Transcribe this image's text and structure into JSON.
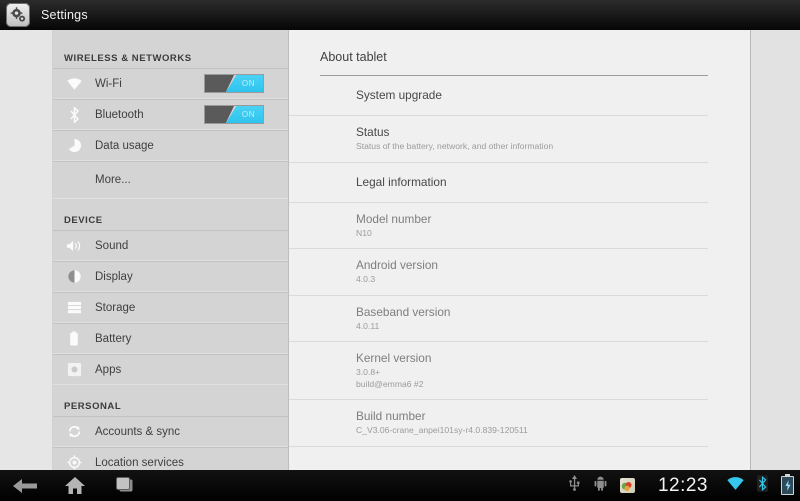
{
  "app": {
    "title": "Settings",
    "icon": "settings-gear-icon"
  },
  "sidebar": {
    "sections": [
      {
        "header": "WIRELESS & NETWORKS",
        "items": [
          {
            "label": "Wi-Fi",
            "icon": "wifi-icon",
            "toggle": "ON"
          },
          {
            "label": "Bluetooth",
            "icon": "bluetooth-icon",
            "toggle": "ON"
          },
          {
            "label": "Data usage",
            "icon": "data-usage-icon"
          },
          {
            "label": "More...",
            "icon": null
          }
        ]
      },
      {
        "header": "DEVICE",
        "items": [
          {
            "label": "Sound",
            "icon": "sound-icon"
          },
          {
            "label": "Display",
            "icon": "display-icon"
          },
          {
            "label": "Storage",
            "icon": "storage-icon"
          },
          {
            "label": "Battery",
            "icon": "battery-icon"
          },
          {
            "label": "Apps",
            "icon": "apps-icon"
          }
        ]
      },
      {
        "header": "PERSONAL",
        "items": [
          {
            "label": "Accounts & sync",
            "icon": "sync-icon"
          },
          {
            "label": "Location services",
            "icon": "location-icon"
          }
        ]
      }
    ]
  },
  "content": {
    "title": "About tablet",
    "items": [
      {
        "title": "System upgrade",
        "subtitle": null,
        "dim": false
      },
      {
        "title": "Status",
        "subtitle": "Status of the battery, network, and other information",
        "dim": false
      },
      {
        "title": "Legal information",
        "subtitle": null,
        "dim": false
      },
      {
        "title": "Model number",
        "subtitle": "N10",
        "dim": true
      },
      {
        "title": "Android version",
        "subtitle": "4.0.3",
        "dim": true
      },
      {
        "title": "Baseband version",
        "subtitle": "4.0.11",
        "dim": true
      },
      {
        "title": "Kernel version",
        "subtitle": "3.0.8+\nbuild@emma6 #2",
        "dim": true
      },
      {
        "title": "Build number",
        "subtitle": "C_V3.06-crane_anpei101sy-r4.0.839-120511",
        "dim": true
      }
    ]
  },
  "systembar": {
    "nav": [
      {
        "name": "back-button",
        "icon": "back-arrow-icon"
      },
      {
        "name": "home-button",
        "icon": "home-icon"
      },
      {
        "name": "recents-button",
        "icon": "recent-apps-icon"
      }
    ],
    "status_icons": [
      "usb-icon",
      "android-debug-icon",
      "notification-app-icon"
    ],
    "clock": "12:23",
    "right_icons": [
      "wifi-signal-icon",
      "bluetooth-status-icon",
      "battery-charging-icon"
    ]
  },
  "colors": {
    "accent_cyan": "#33b5e5",
    "sidebar_bg": "#d4d4d4",
    "content_bg": "#f0f0f0",
    "actionbar_bg": "#1b1b1b"
  }
}
